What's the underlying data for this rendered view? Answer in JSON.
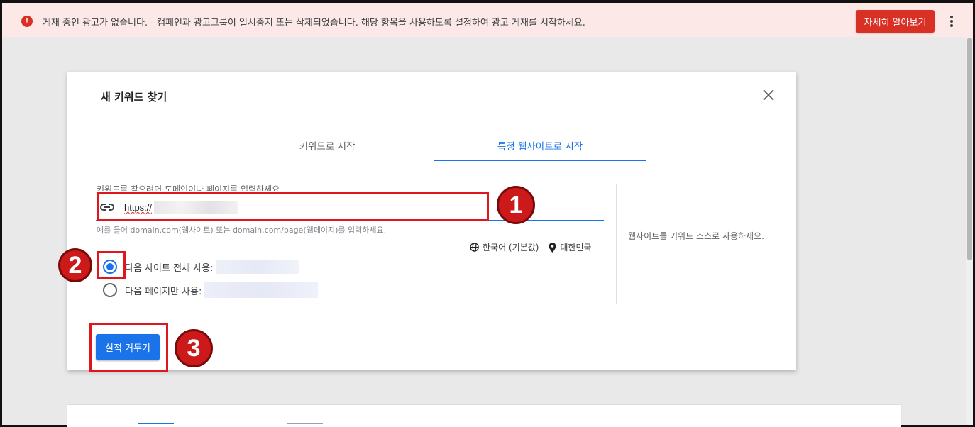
{
  "alert": {
    "icon": "error-icon",
    "icon_glyph": "!",
    "message": "게재 중인 광고가 없습니다. - 캠페인과 광고그룹이 일시중지 또는 삭제되었습니다. 해당 항목을 사용하도록 설정하여 광고 게재를 시작하세요.",
    "learn_more_label": "자세히 알아보기",
    "color": "#d93025"
  },
  "dialog": {
    "title": "새 키워드 찾기",
    "tabs": [
      {
        "label": "키워드로 시작",
        "active": false
      },
      {
        "label": "특정 웹사이트로 시작",
        "active": true
      }
    ],
    "prompt_label": "키워드를 찾으려면 도메인이나 페이지를 입력하세요",
    "url_value": "https://",
    "hint": "예를 들어 domain.com(웹사이트) 또는 domain.com/page(웹페이지)를 입력하세요.",
    "language": "한국어 (기본값)",
    "location": "대한민국",
    "options": [
      {
        "label": "다음 사이트 전체 사용:",
        "checked": true
      },
      {
        "label": "다음 페이지만 사용:",
        "checked": false
      }
    ],
    "side_note": "웹사이트를 키워드 소스로 사용하세요.",
    "submit_label": "실적 거두기",
    "accent_color": "#1a73e8"
  },
  "annotations": {
    "badges": [
      "1",
      "2",
      "3"
    ],
    "color": "#e0161e"
  }
}
